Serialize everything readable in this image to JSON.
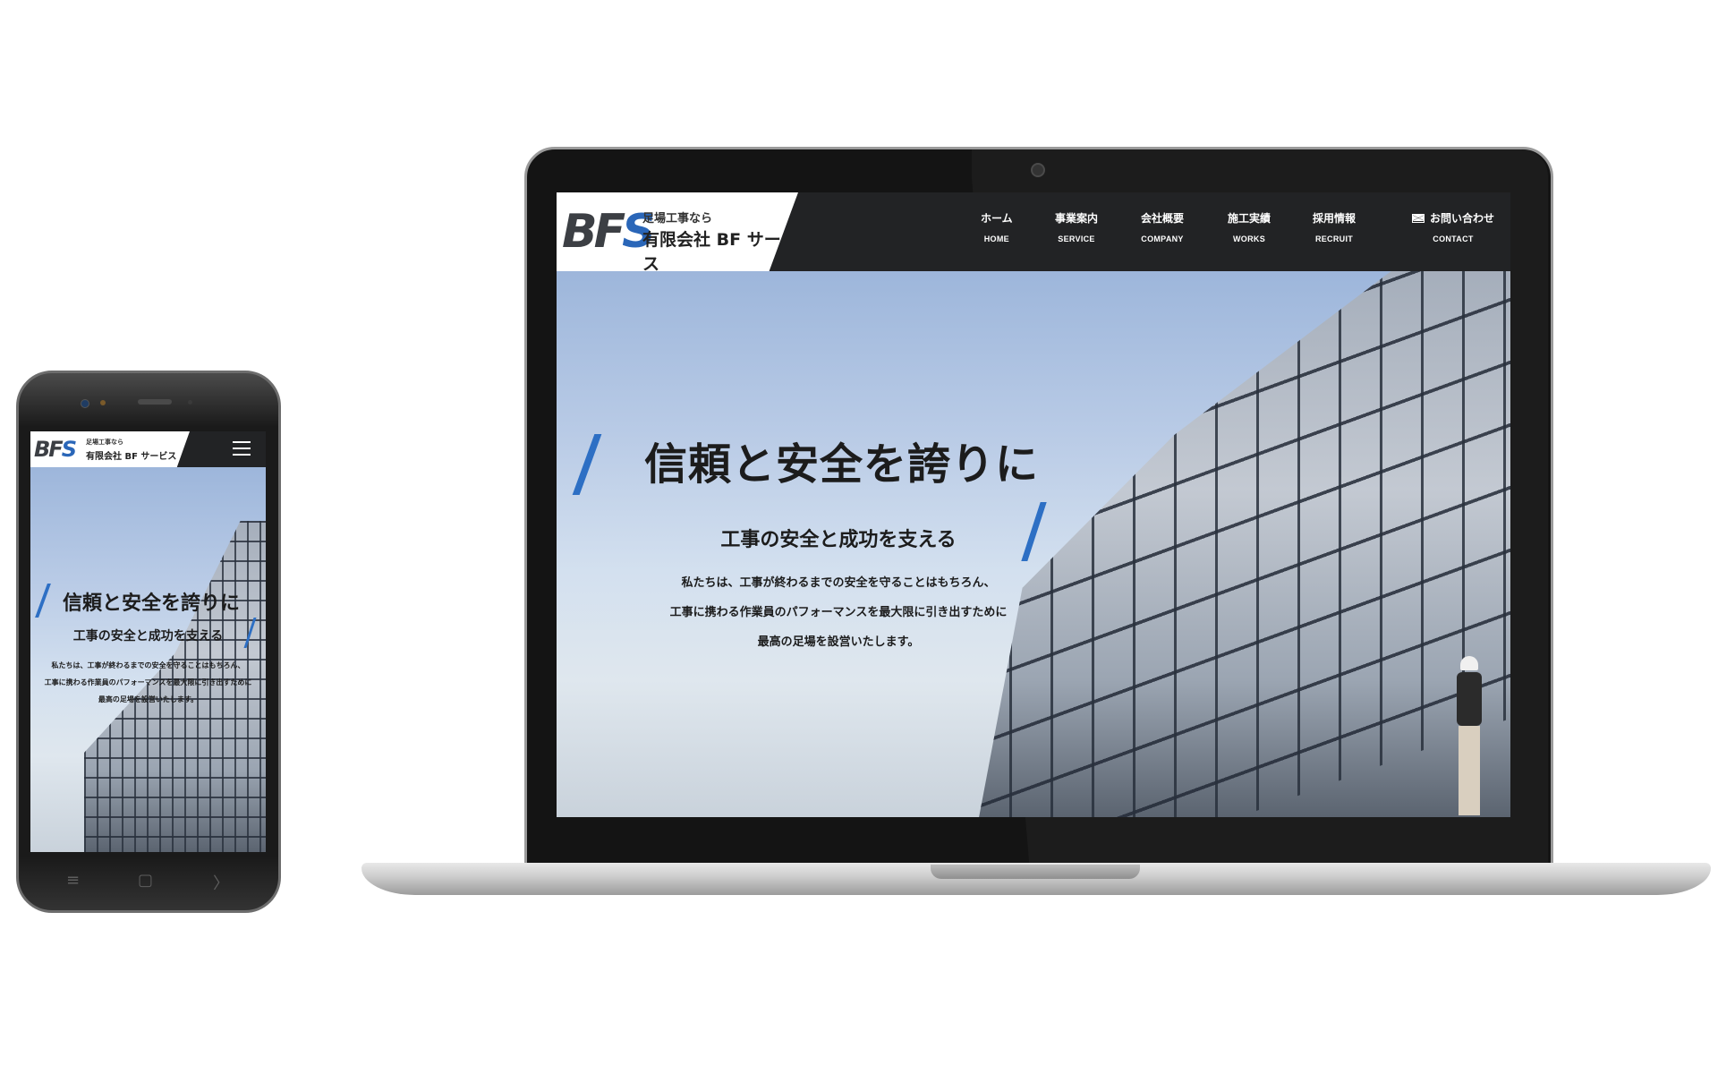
{
  "site": {
    "logo_text": "BFS",
    "tagline": "足場工事なら",
    "company": "有限会社 BF サービス"
  },
  "nav": [
    {
      "jp": "ホーム",
      "en": "HOME"
    },
    {
      "jp": "事業案内",
      "en": "SERVICE"
    },
    {
      "jp": "会社概要",
      "en": "COMPANY"
    },
    {
      "jp": "施工実績",
      "en": "WORKS"
    },
    {
      "jp": "採用情報",
      "en": "RECRUIT"
    },
    {
      "jp": "お問い合わせ",
      "en": "CONTACT",
      "icon": "mail-icon"
    }
  ],
  "hero": {
    "headline": "信頼と安全を誇りに",
    "subheadline": "工事の安全と成功を支える",
    "body": [
      "私たちは、工事が終わるまでの安全を守ることはもちろん、",
      "工事に携わる作業員のパフォーマンスを最大限に引き出すために",
      "最高の足場を設営いたします。"
    ]
  },
  "phone_nav": {
    "menu_icon": "hamburger-menu-icon",
    "system_buttons": [
      "≡",
      "▢",
      "〉"
    ]
  },
  "colors": {
    "header_bg": "#222325",
    "accent_blue": "#2d6fc4",
    "text_dark": "#1c1c1c"
  }
}
